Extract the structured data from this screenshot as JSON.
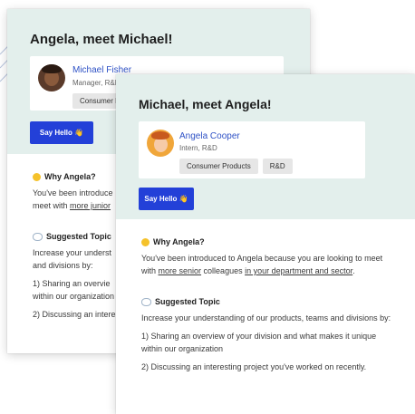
{
  "back_card": {
    "title": "Angela, meet Michael!",
    "profile": {
      "name": "Michael Fisher",
      "role": "Manager, R&D",
      "tags": [
        "Consumer P"
      ]
    },
    "button": "Say Hello 👋",
    "why": {
      "heading": "Why Angela?",
      "line1": "You've been introduce",
      "line2_pre": "meet with ",
      "line2_link": "more junior"
    },
    "topic": {
      "heading": "Suggested Topic",
      "line1": "Increase your underst",
      "line2": "and divisions by:",
      "item1a": "1) Sharing an overvie",
      "item1b": "within our organization",
      "item2": "2) Discussing an intere"
    }
  },
  "front_card": {
    "title": "Michael, meet Angela!",
    "profile": {
      "name": "Angela Cooper",
      "role": "Intern, R&D",
      "tags": [
        "Consumer Products",
        "R&D"
      ]
    },
    "button": "Say Hello 👋",
    "why": {
      "heading": "Why Angela?",
      "text_pre": "You've been introduced to Angela because you are looking to meet with ",
      "link1": "more senior",
      "text_mid": " colleagues ",
      "link2": "in your department and sector",
      "text_end": "."
    },
    "topic": {
      "heading": "Suggested Topic",
      "intro": "Increase your understanding of our products, teams and divisions by:",
      "item1": "1) Sharing an overview of your division and what makes it unique within our organization",
      "item2": "2) Discussing an interesting project you've worked on recently."
    }
  },
  "colors": {
    "header_bg": "#e3efec",
    "button_bg": "#2340d8",
    "link": "#2f52c6",
    "tag_bg": "#e6e6e6"
  }
}
